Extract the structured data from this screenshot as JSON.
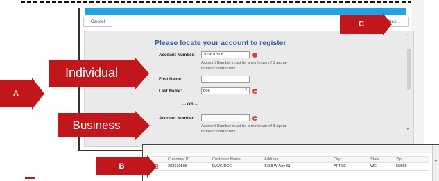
{
  "toolbar": {
    "cancel_label": "Cancel",
    "next_label": "Next"
  },
  "form": {
    "title": "Please locate your account to register",
    "individual": {
      "account_label": "Account Number:",
      "account_value": "303630508",
      "account_hint": "Account Number must be a minimum of 3 alpha-numeric characters",
      "first_name_label": "First Name:",
      "first_name_value": "",
      "last_name_label": "Last Name:",
      "last_name_value": "doe",
      "clear_glyph": "×"
    },
    "or_dash_left": "---",
    "or_label": "OR",
    "or_dash_right": "---",
    "business": {
      "account_label": "Account Number:",
      "account_value": "",
      "account_hint": "Account Number must be a minimum of 3 alpha-numeric characters"
    }
  },
  "callouts": {
    "individual": "Individual",
    "business": "Business",
    "a": "A",
    "b": "B",
    "c": "C"
  },
  "results": {
    "columns": [
      "Customer ID",
      "Customer Name",
      "Address",
      "City",
      "State",
      "Zip"
    ],
    "rows": [
      [
        "303630508",
        "DAVE DOE",
        "1788 W Any St",
        "APPLE",
        "WE",
        "55555"
      ]
    ]
  },
  "icons": {
    "scroll_up": "chevron-up-icon",
    "scroll_down": "chevron-down-icon",
    "remove": "minus-circle-icon"
  },
  "colors": {
    "accent_blue": "#1fa3e4",
    "callout_red": "#c0161c",
    "title_blue": "#2d5fa8"
  }
}
